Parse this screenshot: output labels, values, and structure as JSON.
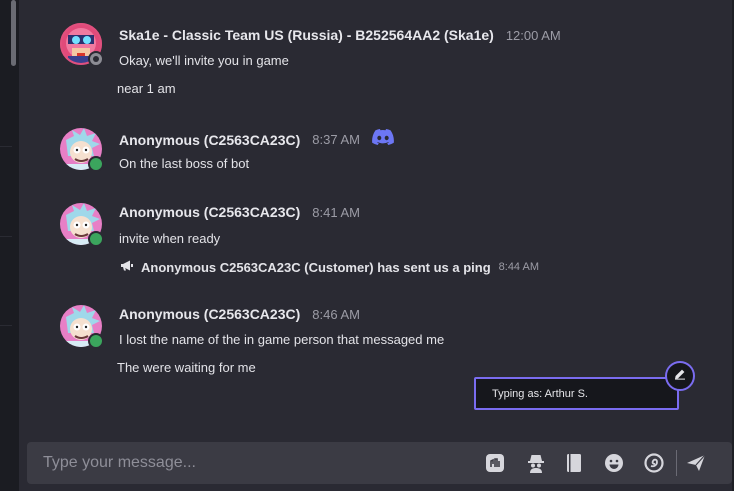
{
  "messages": [
    {
      "author": "Ska1e - Classic Team US (Russia) - B252564AA2 (Ska1e)",
      "time": "12:00 AM",
      "lines": [
        "Okay, we'll invite you in game",
        "near 1 am"
      ],
      "avatar_icon": "hero-portrait-avatar",
      "status": "offline"
    },
    {
      "author": "Anonymous (C2563CA23C)",
      "time": "8:37 AM",
      "source_icon": "discord-icon",
      "lines": [
        "On the last boss of bot"
      ],
      "avatar_icon": "rick-avatar",
      "status": "online"
    },
    {
      "author": "Anonymous (C2563CA23C)",
      "time": "8:41 AM",
      "lines": [
        "invite when ready"
      ],
      "avatar_icon": "rick-avatar",
      "status": "online"
    },
    {
      "author": "Anonymous (C2563CA23C)",
      "time": "8:46 AM",
      "lines": [
        "I lost the name of the in game person that messaged me",
        "The were waiting for me"
      ],
      "avatar_icon": "rick-avatar",
      "status": "online"
    }
  ],
  "system_notice": {
    "icon": "megaphone-icon",
    "text": "Anonymous C2563CA23C (Customer) has sent us a ping",
    "time": "8:44 AM"
  },
  "typing": {
    "label": "Typing as: Arthur S.",
    "edit_icon": "pencil-icon"
  },
  "composer": {
    "placeholder": "Type your message...",
    "tools": [
      "hands-icon",
      "spy-icon",
      "book-icon",
      "emoji-icon",
      "sticker-icon",
      "send-icon"
    ]
  },
  "colors": {
    "accent": "#7a6cf0",
    "discord": "#5865f2",
    "online": "#3ba55d",
    "offline": "#8c8c94"
  }
}
